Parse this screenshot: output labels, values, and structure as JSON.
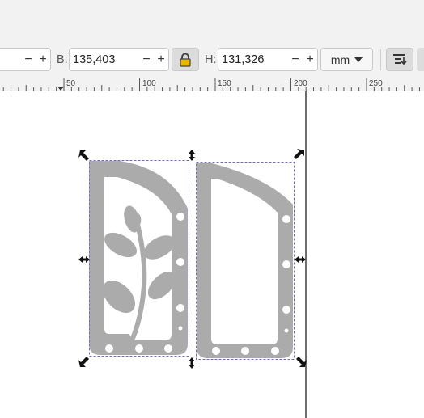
{
  "toolbar": {
    "w_label": "B:",
    "w_value": "135,403",
    "h_label": "H:",
    "h_value": "131,326",
    "minus": "−",
    "plus": "+",
    "unit": "mm",
    "lock_icon": "lock-icon",
    "align_icon": "align-objects-icon"
  },
  "ruler": {
    "labels": [
      "50",
      "100",
      "150",
      "200",
      "250"
    ]
  },
  "colors": {
    "shape_fill": "#ababab",
    "selection_dash": "#6f6fb0",
    "page_edge": "#6e6e6e",
    "lock_fill": "#e6b800"
  }
}
